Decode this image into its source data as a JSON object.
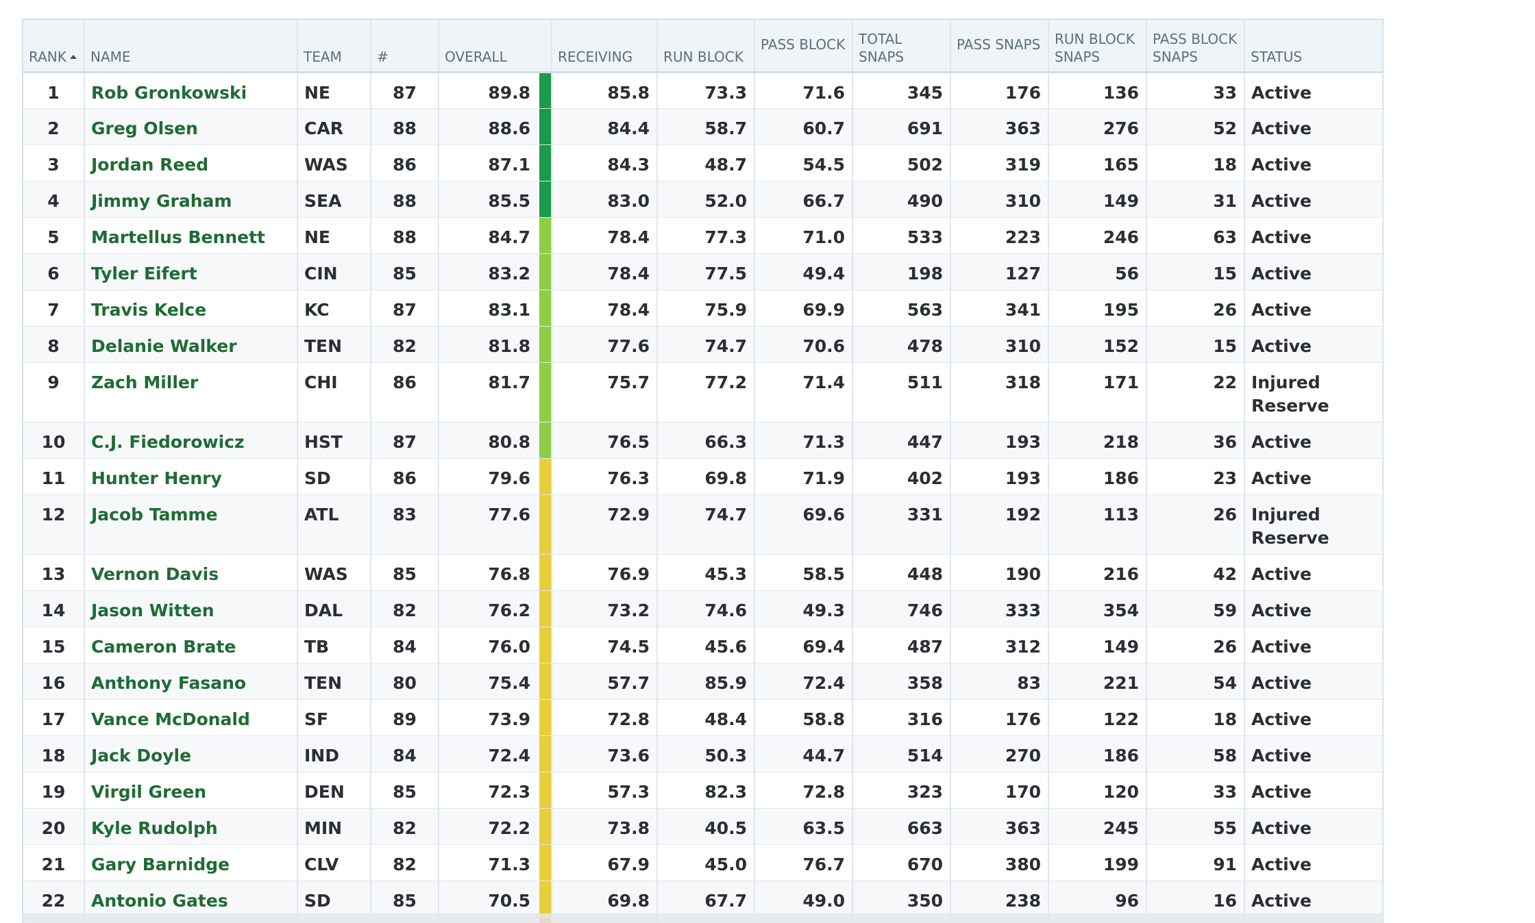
{
  "columns": {
    "rank": "RANK",
    "name": "NAME",
    "team": "TEAM",
    "number": "#",
    "overall": "OVERALL",
    "receiving": "RECEIVING",
    "run_block": "RUN BLOCK",
    "pass_block": "PASS BLOCK",
    "total_snaps": "TOTAL SNAPS",
    "pass_snaps": "PASS SNAPS",
    "run_block_snaps": "RUN BLOCK SNAPS",
    "pass_block_snaps": "PASS BLOCK SNAPS",
    "status": "STATUS"
  },
  "sort": {
    "column": "rank",
    "direction": "ascending"
  },
  "grade_colors": {
    "elite": "#1a9a4a",
    "high": "#8ccf45",
    "average": "#e8cf3a",
    "below": "#ef7d2a"
  },
  "rows": [
    {
      "rank": "1",
      "name": "Rob Gronkowski",
      "team": "NE",
      "number": "87",
      "overall": "89.8",
      "receiving": "85.8",
      "run_block": "73.3",
      "pass_block": "71.6",
      "total_snaps": "345",
      "pass_snaps": "176",
      "run_block_snaps": "136",
      "pass_block_snaps": "33",
      "status": "Active",
      "grade": "#1a9a4a"
    },
    {
      "rank": "2",
      "name": "Greg Olsen",
      "team": "CAR",
      "number": "88",
      "overall": "88.6",
      "receiving": "84.4",
      "run_block": "58.7",
      "pass_block": "60.7",
      "total_snaps": "691",
      "pass_snaps": "363",
      "run_block_snaps": "276",
      "pass_block_snaps": "52",
      "status": "Active",
      "grade": "#1a9a4a"
    },
    {
      "rank": "3",
      "name": "Jordan Reed",
      "team": "WAS",
      "number": "86",
      "overall": "87.1",
      "receiving": "84.3",
      "run_block": "48.7",
      "pass_block": "54.5",
      "total_snaps": "502",
      "pass_snaps": "319",
      "run_block_snaps": "165",
      "pass_block_snaps": "18",
      "status": "Active",
      "grade": "#1a9a4a"
    },
    {
      "rank": "4",
      "name": "Jimmy Graham",
      "team": "SEA",
      "number": "88",
      "overall": "85.5",
      "receiving": "83.0",
      "run_block": "52.0",
      "pass_block": "66.7",
      "total_snaps": "490",
      "pass_snaps": "310",
      "run_block_snaps": "149",
      "pass_block_snaps": "31",
      "status": "Active",
      "grade": "#1a9a4a"
    },
    {
      "rank": "5",
      "name": "Martellus Bennett",
      "team": "NE",
      "number": "88",
      "overall": "84.7",
      "receiving": "78.4",
      "run_block": "77.3",
      "pass_block": "71.0",
      "total_snaps": "533",
      "pass_snaps": "223",
      "run_block_snaps": "246",
      "pass_block_snaps": "63",
      "status": "Active",
      "grade": "#8ccf45"
    },
    {
      "rank": "6",
      "name": "Tyler Eifert",
      "team": "CIN",
      "number": "85",
      "overall": "83.2",
      "receiving": "78.4",
      "run_block": "77.5",
      "pass_block": "49.4",
      "total_snaps": "198",
      "pass_snaps": "127",
      "run_block_snaps": "56",
      "pass_block_snaps": "15",
      "status": "Active",
      "grade": "#8ccf45"
    },
    {
      "rank": "7",
      "name": "Travis Kelce",
      "team": "KC",
      "number": "87",
      "overall": "83.1",
      "receiving": "78.4",
      "run_block": "75.9",
      "pass_block": "69.9",
      "total_snaps": "563",
      "pass_snaps": "341",
      "run_block_snaps": "195",
      "pass_block_snaps": "26",
      "status": "Active",
      "grade": "#8ccf45"
    },
    {
      "rank": "8",
      "name": "Delanie Walker",
      "team": "TEN",
      "number": "82",
      "overall": "81.8",
      "receiving": "77.6",
      "run_block": "74.7",
      "pass_block": "70.6",
      "total_snaps": "478",
      "pass_snaps": "310",
      "run_block_snaps": "152",
      "pass_block_snaps": "15",
      "status": "Active",
      "grade": "#8ccf45"
    },
    {
      "rank": "9",
      "name": "Zach Miller",
      "team": "CHI",
      "number": "86",
      "overall": "81.7",
      "receiving": "75.7",
      "run_block": "77.2",
      "pass_block": "71.4",
      "total_snaps": "511",
      "pass_snaps": "318",
      "run_block_snaps": "171",
      "pass_block_snaps": "22",
      "status": "Injured Reserve",
      "grade": "#8ccf45"
    },
    {
      "rank": "10",
      "name": "C.J. Fiedorowicz",
      "team": "HST",
      "number": "87",
      "overall": "80.8",
      "receiving": "76.5",
      "run_block": "66.3",
      "pass_block": "71.3",
      "total_snaps": "447",
      "pass_snaps": "193",
      "run_block_snaps": "218",
      "pass_block_snaps": "36",
      "status": "Active",
      "grade": "#8ccf45"
    },
    {
      "rank": "11",
      "name": "Hunter Henry",
      "team": "SD",
      "number": "86",
      "overall": "79.6",
      "receiving": "76.3",
      "run_block": "69.8",
      "pass_block": "71.9",
      "total_snaps": "402",
      "pass_snaps": "193",
      "run_block_snaps": "186",
      "pass_block_snaps": "23",
      "status": "Active",
      "grade": "#e8cf3a"
    },
    {
      "rank": "12",
      "name": "Jacob Tamme",
      "team": "ATL",
      "number": "83",
      "overall": "77.6",
      "receiving": "72.9",
      "run_block": "74.7",
      "pass_block": "69.6",
      "total_snaps": "331",
      "pass_snaps": "192",
      "run_block_snaps": "113",
      "pass_block_snaps": "26",
      "status": "Injured Reserve",
      "grade": "#e8cf3a"
    },
    {
      "rank": "13",
      "name": "Vernon Davis",
      "team": "WAS",
      "number": "85",
      "overall": "76.8",
      "receiving": "76.9",
      "run_block": "45.3",
      "pass_block": "58.5",
      "total_snaps": "448",
      "pass_snaps": "190",
      "run_block_snaps": "216",
      "pass_block_snaps": "42",
      "status": "Active",
      "grade": "#e8cf3a"
    },
    {
      "rank": "14",
      "name": "Jason Witten",
      "team": "DAL",
      "number": "82",
      "overall": "76.2",
      "receiving": "73.2",
      "run_block": "74.6",
      "pass_block": "49.3",
      "total_snaps": "746",
      "pass_snaps": "333",
      "run_block_snaps": "354",
      "pass_block_snaps": "59",
      "status": "Active",
      "grade": "#e8cf3a"
    },
    {
      "rank": "15",
      "name": "Cameron Brate",
      "team": "TB",
      "number": "84",
      "overall": "76.0",
      "receiving": "74.5",
      "run_block": "45.6",
      "pass_block": "69.4",
      "total_snaps": "487",
      "pass_snaps": "312",
      "run_block_snaps": "149",
      "pass_block_snaps": "26",
      "status": "Active",
      "grade": "#e8cf3a"
    },
    {
      "rank": "16",
      "name": "Anthony Fasano",
      "team": "TEN",
      "number": "80",
      "overall": "75.4",
      "receiving": "57.7",
      "run_block": "85.9",
      "pass_block": "72.4",
      "total_snaps": "358",
      "pass_snaps": "83",
      "run_block_snaps": "221",
      "pass_block_snaps": "54",
      "status": "Active",
      "grade": "#e8cf3a"
    },
    {
      "rank": "17",
      "name": "Vance McDonald",
      "team": "SF",
      "number": "89",
      "overall": "73.9",
      "receiving": "72.8",
      "run_block": "48.4",
      "pass_block": "58.8",
      "total_snaps": "316",
      "pass_snaps": "176",
      "run_block_snaps": "122",
      "pass_block_snaps": "18",
      "status": "Active",
      "grade": "#e8cf3a"
    },
    {
      "rank": "18",
      "name": "Jack Doyle",
      "team": "IND",
      "number": "84",
      "overall": "72.4",
      "receiving": "73.6",
      "run_block": "50.3",
      "pass_block": "44.7",
      "total_snaps": "514",
      "pass_snaps": "270",
      "run_block_snaps": "186",
      "pass_block_snaps": "58",
      "status": "Active",
      "grade": "#e8cf3a"
    },
    {
      "rank": "19",
      "name": "Virgil Green",
      "team": "DEN",
      "number": "85",
      "overall": "72.3",
      "receiving": "57.3",
      "run_block": "82.3",
      "pass_block": "72.8",
      "total_snaps": "323",
      "pass_snaps": "170",
      "run_block_snaps": "120",
      "pass_block_snaps": "33",
      "status": "Active",
      "grade": "#e8cf3a"
    },
    {
      "rank": "20",
      "name": "Kyle Rudolph",
      "team": "MIN",
      "number": "82",
      "overall": "72.2",
      "receiving": "73.8",
      "run_block": "40.5",
      "pass_block": "63.5",
      "total_snaps": "663",
      "pass_snaps": "363",
      "run_block_snaps": "245",
      "pass_block_snaps": "55",
      "status": "Active",
      "grade": "#e8cf3a"
    },
    {
      "rank": "21",
      "name": "Gary Barnidge",
      "team": "CLV",
      "number": "82",
      "overall": "71.3",
      "receiving": "67.9",
      "run_block": "45.0",
      "pass_block": "76.7",
      "total_snaps": "670",
      "pass_snaps": "380",
      "run_block_snaps": "199",
      "pass_block_snaps": "91",
      "status": "Active",
      "grade": "#e8cf3a"
    },
    {
      "rank": "22",
      "name": "Antonio Gates",
      "team": "SD",
      "number": "85",
      "overall": "70.5",
      "receiving": "69.8",
      "run_block": "67.7",
      "pass_block": "49.0",
      "total_snaps": "350",
      "pass_snaps": "238",
      "run_block_snaps": "96",
      "pass_block_snaps": "16",
      "status": "Active",
      "grade": "#e8cf3a"
    },
    {
      "rank": "",
      "name": "",
      "team": "",
      "number": "",
      "overall": "",
      "receiving": "",
      "run_block": "",
      "pass_block": "",
      "total_snaps": "",
      "pass_snaps": "",
      "run_block_snaps": "",
      "pass_block_snaps": "",
      "status": "",
      "grade": "#ef7d2a"
    }
  ]
}
